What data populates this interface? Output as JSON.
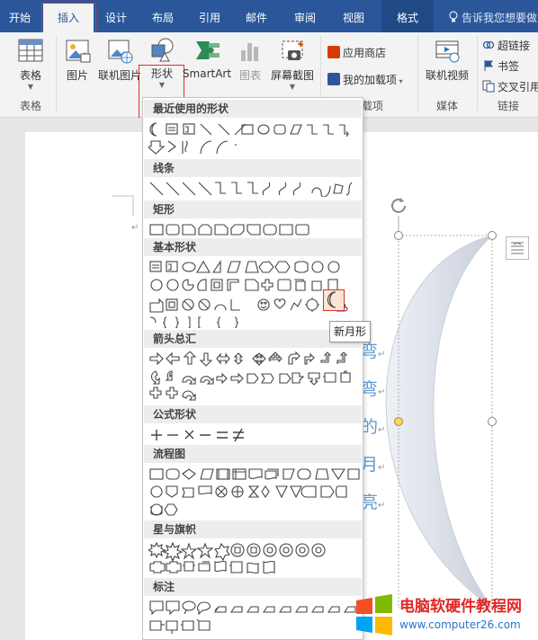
{
  "ribbon_tabs": [
    "开始",
    "插入",
    "设计",
    "布局",
    "引用",
    "邮件",
    "审阅",
    "视图",
    "格式"
  ],
  "tell_me": "告诉我您想要做",
  "buttons": {
    "table": "表格",
    "picture": "图片",
    "online_picture": "联机图片",
    "shapes": "形状",
    "smartart": "SmartArt",
    "chart": "图表",
    "screenshot": "屏幕截图",
    "app_store": "应用商店",
    "my_addins": "我的加载项",
    "online_video": "联机视频",
    "hyperlink": "超链接",
    "bookmark": "书签",
    "cross_reference": "交叉引用"
  },
  "group_labels": {
    "tables": "表格",
    "addins": "加载项",
    "media": "媒体",
    "links": "链接"
  },
  "shapes_menu": {
    "sections": [
      "最近使用的形状",
      "线条",
      "矩形",
      "基本形状",
      "箭头总汇",
      "公式形状",
      "流程图",
      "星与旗帜",
      "标注"
    ],
    "tooltip": "新月形"
  },
  "document": {
    "moon_chars": [
      "弯",
      "弯",
      "的",
      "月",
      "亮"
    ]
  },
  "watermark": {
    "title": "电脑软硬件教程网",
    "url": "www.computer26.com"
  },
  "colors": {
    "ribbon_blue": "#2b579a",
    "highlight_red": "#d9312b",
    "text_blue": "#5b9bd5"
  }
}
